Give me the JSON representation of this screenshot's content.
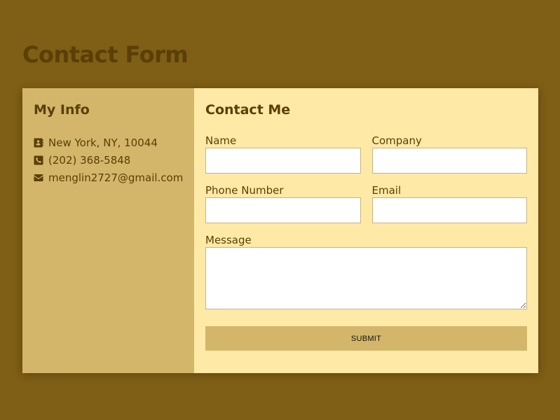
{
  "page": {
    "title": "Contact Form"
  },
  "info": {
    "heading": "My Info",
    "items": [
      {
        "icon": "address-card-icon",
        "text": "New York, NY, 10044"
      },
      {
        "icon": "phone-square-icon",
        "text": "(202) 368-5848"
      },
      {
        "icon": "envelope-icon",
        "text": "menglin2727@gmail.com"
      }
    ]
  },
  "form": {
    "heading": "Contact Me",
    "name_label": "Name",
    "name_value": "",
    "company_label": "Company",
    "company_value": "",
    "phone_label": "Phone Number",
    "phone_value": "",
    "email_label": "Email",
    "email_value": "",
    "message_label": "Message",
    "message_value": "",
    "submit_label": "SUBMIT"
  },
  "colors": {
    "background": "#7f5e15",
    "info_panel": "#d3b66a",
    "form_panel": "#ffe9a6",
    "text": "#5a3f06",
    "button": "#d3b66a"
  }
}
